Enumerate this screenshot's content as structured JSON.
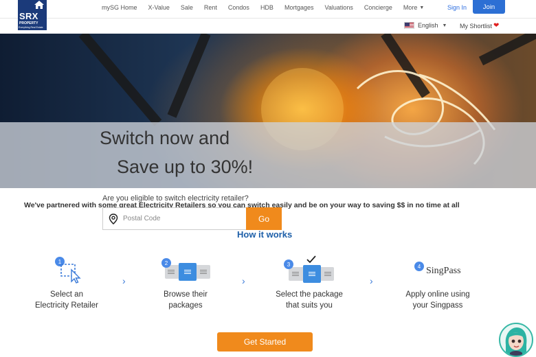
{
  "header": {
    "logo_text": "SRX",
    "logo_sub": "PROPERTY",
    "logo_tagline": "Everything Real Estate",
    "nav": [
      "mySG Home",
      "X-Value",
      "Sale",
      "Rent",
      "Condos",
      "HDB",
      "Mortgages",
      "Valuations",
      "Concierge"
    ],
    "more_label": "More",
    "signin_label": "Sign In",
    "join_label": "Join",
    "language_label": "English",
    "shortlist_label": "My Shortlist"
  },
  "hero": {
    "line1": "Switch now and",
    "line2": "Save up to 30%!"
  },
  "form": {
    "eligible_text": "Are you eligible to switch electricity retailer?",
    "partner_text": "We've partnered with some great Electricity Retailers so you can switch easily and be on your way to saving $$ in no time at all",
    "postal_placeholder": "Postal Code",
    "go_label": "Go"
  },
  "how": {
    "title": "How it works",
    "steps": [
      {
        "num": "1",
        "line1": "Select an",
        "line2": "Electricity Retailer"
      },
      {
        "num": "2",
        "line1": "Browse their",
        "line2": "packages"
      },
      {
        "num": "3",
        "line1": "Select the package",
        "line2": "that suits you"
      },
      {
        "num": "4",
        "line1": "Apply online using",
        "line2": "your Singpass"
      }
    ],
    "singpass_logo": "SingPass"
  },
  "cta_label": "Get Started",
  "colors": {
    "brand_navy": "#1b3a7a",
    "accent_orange": "#f08a1c",
    "link_blue": "#1d5fa8",
    "step_blue": "#4a8ae8"
  }
}
